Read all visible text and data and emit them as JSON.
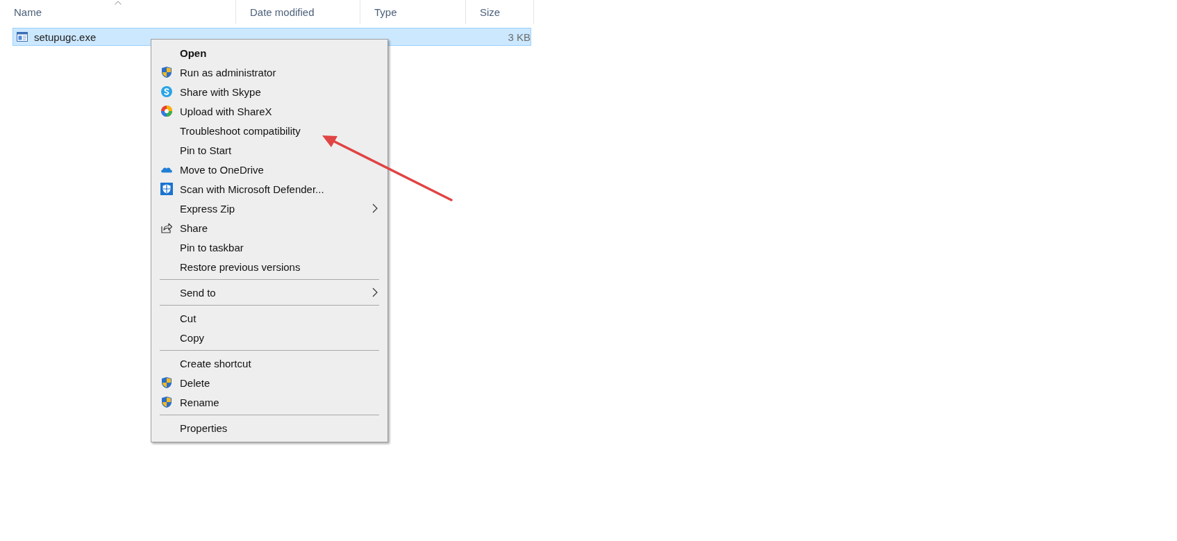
{
  "columns": [
    {
      "label": "Name",
      "sorted": true
    },
    {
      "label": "Date modified",
      "sorted": false
    },
    {
      "label": "Type",
      "sorted": false
    },
    {
      "label": "Size",
      "sorted": false
    }
  ],
  "files": [
    {
      "name": "setupugc.exe",
      "size": "3 KB",
      "selected": true
    }
  ],
  "context_menu": {
    "groups": [
      [
        {
          "label": "Open",
          "kind": "plain",
          "default": true,
          "submenu": false
        },
        {
          "label": "Run as administrator",
          "kind": "shield",
          "default": false,
          "submenu": false
        },
        {
          "label": "Share with Skype",
          "kind": "skype",
          "default": false,
          "submenu": false
        },
        {
          "label": "Upload with ShareX",
          "kind": "sharex",
          "default": false,
          "submenu": false
        },
        {
          "label": "Troubleshoot compatibility",
          "kind": "plain",
          "default": false,
          "submenu": false
        },
        {
          "label": "Pin to Start",
          "kind": "plain",
          "default": false,
          "submenu": false
        },
        {
          "label": "Move to OneDrive",
          "kind": "cloud",
          "default": false,
          "submenu": false
        },
        {
          "label": "Scan with Microsoft Defender...",
          "kind": "defender",
          "default": false,
          "submenu": false
        },
        {
          "label": "Express Zip",
          "kind": "plain",
          "default": false,
          "submenu": true
        },
        {
          "label": "Share",
          "kind": "share",
          "default": false,
          "submenu": false
        },
        {
          "label": "Pin to taskbar",
          "kind": "plain",
          "default": false,
          "submenu": false
        },
        {
          "label": "Restore previous versions",
          "kind": "plain",
          "default": false,
          "submenu": false
        }
      ],
      [
        {
          "label": "Send to",
          "kind": "plain",
          "default": false,
          "submenu": true
        }
      ],
      [
        {
          "label": "Cut",
          "kind": "plain",
          "default": false,
          "submenu": false
        },
        {
          "label": "Copy",
          "kind": "plain",
          "default": false,
          "submenu": false
        }
      ],
      [
        {
          "label": "Create shortcut",
          "kind": "plain",
          "default": false,
          "submenu": false
        },
        {
          "label": "Delete",
          "kind": "shield",
          "default": false,
          "submenu": false
        },
        {
          "label": "Rename",
          "kind": "shield",
          "default": false,
          "submenu": false
        }
      ],
      [
        {
          "label": "Properties",
          "kind": "plain",
          "default": false,
          "submenu": false
        }
      ]
    ]
  }
}
